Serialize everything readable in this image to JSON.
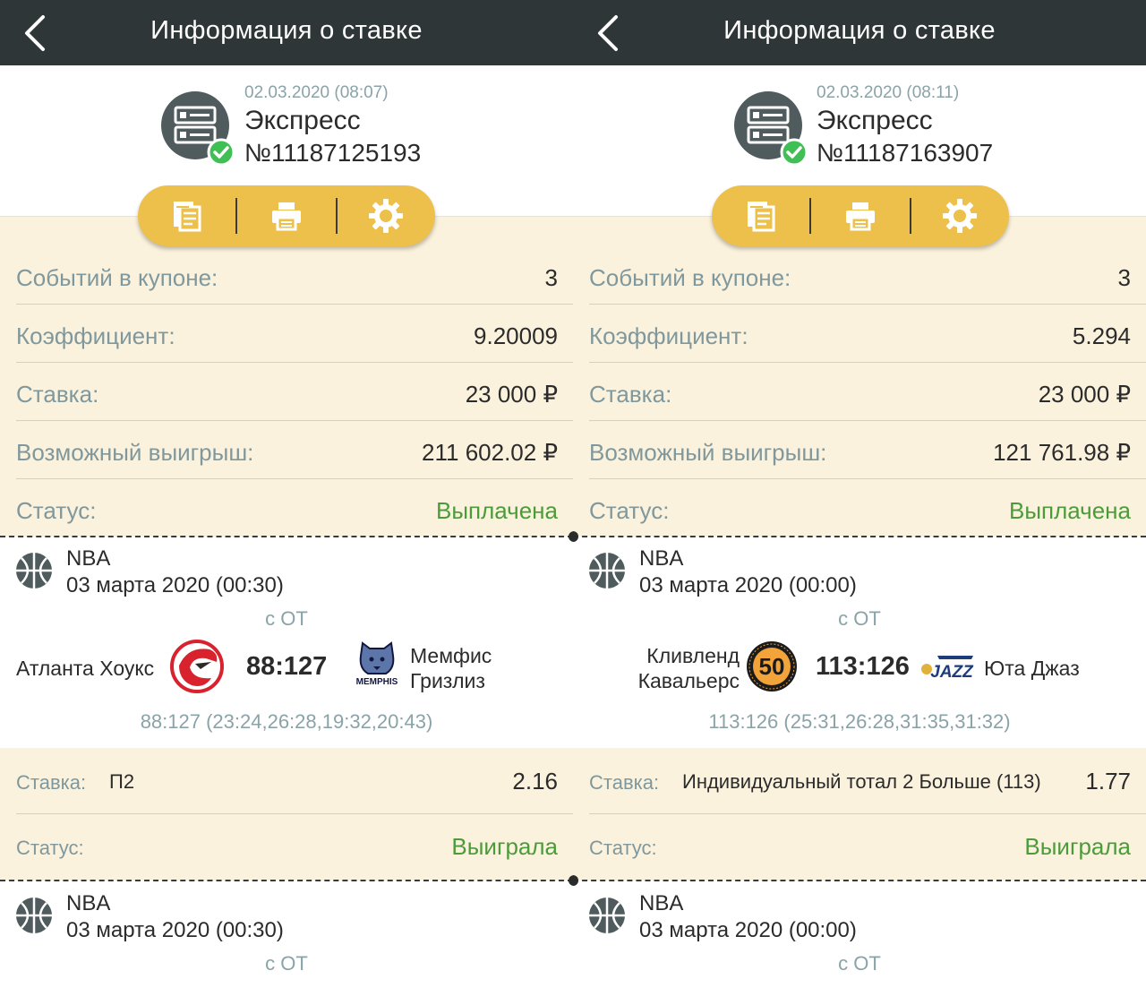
{
  "screens": [
    {
      "header": {
        "title": "Информация о ставке"
      },
      "bet": {
        "date": "02.03.2020 (08:07)",
        "type": "Экспресс",
        "number": "№11187125193"
      },
      "summary": [
        {
          "label": "Событий в купоне:",
          "value": "3"
        },
        {
          "label": "Коэффициент:",
          "value": "9.20009"
        },
        {
          "label": "Ставка:",
          "value": "23 000 ₽"
        },
        {
          "label": "Возможный выигрыш:",
          "value": "211 602.02 ₽"
        },
        {
          "label": "Статус:",
          "value": "Выплачена"
        }
      ],
      "event1": {
        "league": "NBA",
        "date": "03 марта 2020 (00:30)",
        "ot": "с ОТ",
        "home_line1": "Атланта Хоукс",
        "home_line2": "",
        "away_line1": "Мемфис",
        "away_line2": "Гризлиз",
        "score": "88:127",
        "periods": "88:127 (23:24,26:28,19:32,20:43)"
      },
      "selection": {
        "label": "Ставка:",
        "pick": "П2",
        "odd": "2.16",
        "status_label": "Статус:",
        "status": "Выиграла"
      },
      "event2": {
        "league": "NBA",
        "date": "03 марта 2020 (00:30)",
        "ot": "с ОТ"
      }
    },
    {
      "header": {
        "title": "Информация о ставке"
      },
      "bet": {
        "date": "02.03.2020 (08:11)",
        "type": "Экспресс",
        "number": "№11187163907"
      },
      "summary": [
        {
          "label": "Событий в купоне:",
          "value": "3"
        },
        {
          "label": "Коэффициент:",
          "value": "5.294"
        },
        {
          "label": "Ставка:",
          "value": "23 000 ₽"
        },
        {
          "label": "Возможный выигрыш:",
          "value": "121 761.98 ₽"
        },
        {
          "label": "Статус:",
          "value": "Выплачена"
        }
      ],
      "event1": {
        "league": "NBA",
        "date": "03 марта 2020 (00:00)",
        "ot": "с ОТ",
        "home_line1": "Кливленд",
        "home_line2": "Кавальерс",
        "away_line1": "Юта Джаз",
        "away_line2": "",
        "score": "113:126",
        "periods": "113:126 (25:31,26:28,31:35,31:32)"
      },
      "selection": {
        "label": "Ставка:",
        "pick": "Индивидуальный тотал 2 Больше (113)",
        "odd": "1.77",
        "status_label": "Статус:",
        "status": "Выиграла"
      },
      "event2": {
        "league": "NBA",
        "date": "03 марта 2020 (00:00)",
        "ot": "с ОТ"
      }
    }
  ],
  "logo_text": {
    "memphis": "MEMPHIS",
    "cavs": "50",
    "jazz": "JAZZ"
  },
  "colors": {
    "header_bg": "#2f3638",
    "accent_yellow": "#ecc04a",
    "summary_bg": "#fbf2dd",
    "label_gray": "#7f989d",
    "status_green": "#4c9b3a",
    "check_green": "#3fbf54",
    "icon_dark": "#4f5b5d"
  },
  "icons": {
    "back": "chevron-left-icon",
    "bet_type": "express-coupon-icon",
    "confirmed": "check-badge-icon",
    "toolbar": [
      "copy-document-icon",
      "print-icon",
      "settings-gear-icon"
    ],
    "sport": "basketball-icon"
  }
}
